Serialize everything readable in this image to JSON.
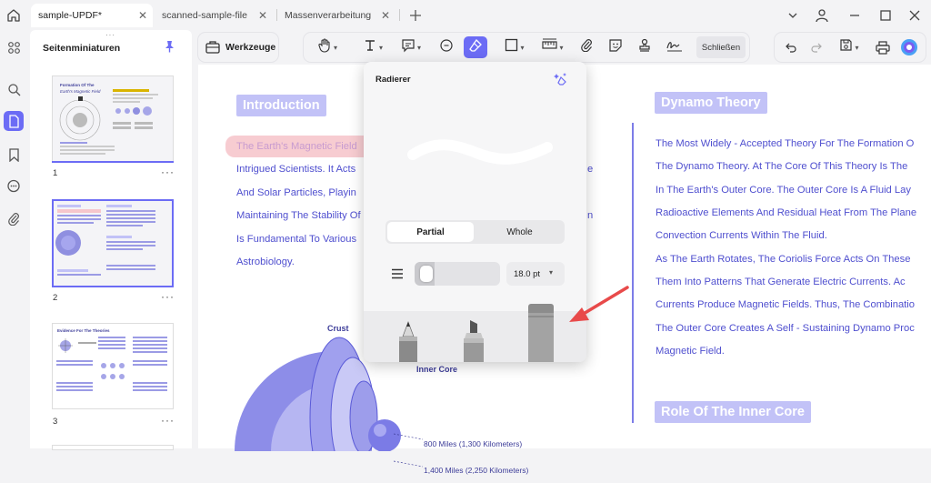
{
  "tabs": [
    {
      "label": "sample-UPDF*",
      "active": true
    },
    {
      "label": "scanned-sample-file",
      "active": false
    },
    {
      "label": "Massenverarbeitung",
      "active": false
    }
  ],
  "sidebar": {
    "title": "Seitenminiaturen",
    "pages": [
      {
        "number": "1",
        "thumb_title_a": "Formation Of The",
        "thumb_title_b": "Earth's Magnetic Field"
      },
      {
        "number": "2"
      },
      {
        "number": "3",
        "thumb_title_a": "Evidence For The Theories"
      }
    ]
  },
  "toolbar": {
    "tools_label": "Werkzeuge",
    "close_label": "Schließen"
  },
  "eraser_popup": {
    "title": "Radierer",
    "modes": [
      "Partial",
      "Whole"
    ],
    "active_mode": "Partial",
    "size_value": "18.0 pt",
    "size_level_fraction": 0.08
  },
  "document": {
    "left": {
      "heading": "Introduction",
      "lines": [
        "The Earth's Magnetic Field",
        "Intrigued Scientists. It Acts",
        "And Solar Particles, Playin",
        "Maintaining The Stability Of",
        "Is Fundamental To Various",
        "Astrobiology."
      ],
      "line_tails": [
        "",
        "e",
        "",
        "n",
        "",
        ""
      ],
      "diagram_labels": {
        "crust": "Crust",
        "inner_core": "Inner Core",
        "d1": "800 Miles (1,300 Kilometers)",
        "d2": "1,400 Miles (2,250 Kilometers)"
      }
    },
    "right": {
      "heading": "Dynamo Theory",
      "lines": [
        "The Most Widely - Accepted Theory For The Formation O",
        "The Dynamo Theory. At The Core Of This Theory Is The",
        "In The Earth's Outer Core. The Outer Core Is A Fluid Lay",
        "Radioactive Elements And Residual Heat From The Plane",
        "Convection Currents Within The Fluid.",
        "As The Earth Rotates, The Coriolis Force Acts On These",
        "Them Into Patterns That Generate Electric Currents. Ac",
        "Currents Produce Magnetic Fields. Thus, The Combinatio",
        "The Outer Core Creates A Self - Sustaining Dynamo Proc",
        "Magnetic Field."
      ],
      "heading2": "Role Of The Inner Core"
    }
  },
  "colors": {
    "accent": "#6c6cf5",
    "heading_bg": "#c2c2f7",
    "body_text": "#4f4fcf",
    "highlight": "#f6c6cc",
    "arrow": "#e84a4a"
  }
}
